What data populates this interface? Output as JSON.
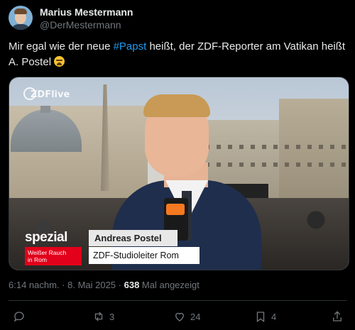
{
  "author": {
    "name": "Marius Mestermann",
    "handle": "@DerMestermann"
  },
  "tweet": {
    "text_before": "Mir egal wie der neue ",
    "hashtag": "#Papst",
    "text_after": " heißt, der ZDF-Reporter am Vatikan heißt A. Postel ",
    "emoji": "crying-laughing-emoji"
  },
  "media": {
    "channel_logo": "ZDFlive",
    "spezial_label": "spezial",
    "red_caption_line1": "Weißer Rauch",
    "red_caption_line2": "in Rom",
    "reporter_name": "Andreas Postel",
    "reporter_title": "ZDF-Studioleiter Rom"
  },
  "meta": {
    "time": "6:14 nachm.",
    "separator": " · ",
    "date": "8. Mai 2025",
    "separator2": " · ",
    "views": "638",
    "views_label": " Mal angezeigt"
  },
  "actions": {
    "reply_icon": "reply-icon",
    "retweet_count": "3",
    "like_count": "24",
    "bookmark_count": "4"
  },
  "colors": {
    "background": "#000000",
    "text": "#e7e9ea",
    "muted": "#71767b",
    "accent": "#1d9bf0",
    "zdf_red": "#e2001a"
  }
}
